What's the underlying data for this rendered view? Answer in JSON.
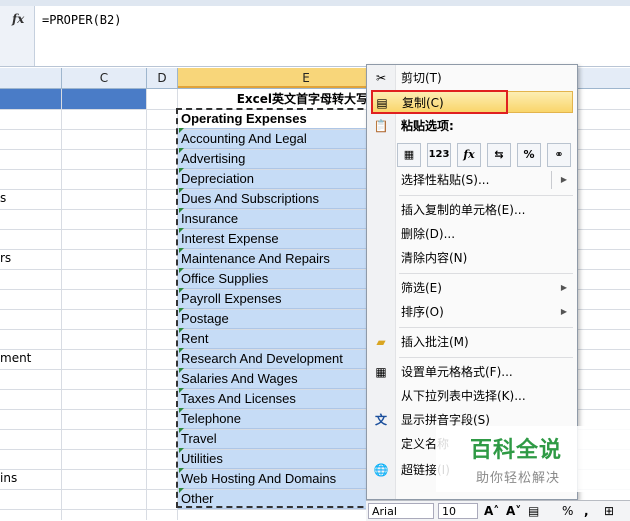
{
  "formula_bar": {
    "fx_label": "fx",
    "formula": "=PROPER(B2)"
  },
  "columns": {
    "c": "C",
    "d": "D",
    "e": "E"
  },
  "left_edge_fragments": [
    "s",
    "rs",
    "ment",
    "ins"
  ],
  "column_e": {
    "title": "Excel英文首字母转大写",
    "cells": [
      "Operating Expenses",
      "Accounting And Legal",
      "Advertising",
      "Depreciation",
      "Dues And Subscriptions",
      "Insurance",
      "Interest Expense",
      "Maintenance And Repairs",
      "Office Supplies",
      "Payroll Expenses",
      "Postage",
      "Rent",
      "Research And Development",
      "Salaries And Wages",
      "Taxes And Licenses",
      "Telephone",
      "Travel",
      "Utilities",
      "Web Hosting And Domains",
      "Other"
    ]
  },
  "context_menu": {
    "cut": "剪切(T)",
    "copy": "复制(C)",
    "paste_options_label": "粘贴选项:",
    "paste_options": [
      "clipboard",
      "123",
      "fx",
      "transpose",
      "%",
      "link"
    ],
    "paste_special": "选择性粘贴(S)...",
    "insert_copied": "插入复制的单元格(E)...",
    "delete": "删除(D)...",
    "clear": "清除内容(N)",
    "filter": "筛选(E)",
    "sort": "排序(O)",
    "insert_comment": "插入批注(M)",
    "format_cells": "设置单元格格式(F)...",
    "pick_list": "从下拉列表中选择(K)...",
    "phonetic": "显示拼音字段(S)",
    "define_name": "定义名称",
    "hyperlink": "超链接(I)"
  },
  "mini_toolbar": {
    "font": "Arial",
    "size": "10"
  },
  "watermark": {
    "title": "百科全说",
    "subtitle": "助你轻松解决"
  }
}
